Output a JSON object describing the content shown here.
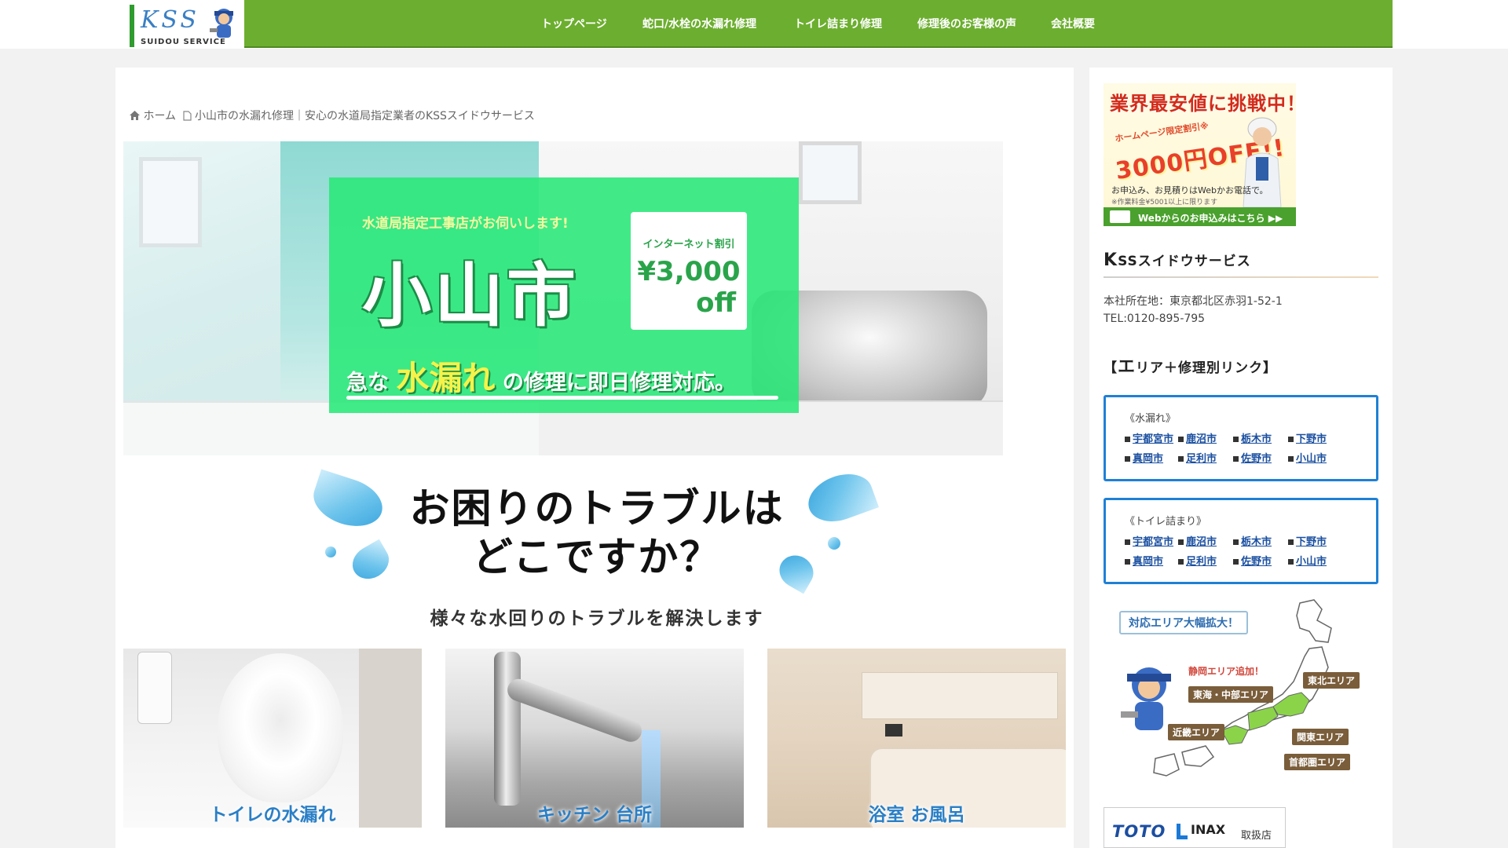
{
  "header": {
    "logo_text": "KSS",
    "logo_sub": "SUIDOU SERVICE",
    "nav": [
      "トップページ",
      "蛇口/水栓の水漏れ修理",
      "トイレ詰まり修理",
      "修理後のお客様の声",
      "会社概要"
    ]
  },
  "breadcrumb": {
    "home": "ホーム",
    "current": "小山市の水漏れ修理｜安心の水道局指定業者のKSSスイドウサービス"
  },
  "hero": {
    "top_line": "水道局指定工事店がお伺いします!",
    "city": "小山市",
    "discount_label": "インターネット割引",
    "discount_amount": "¥3,000",
    "discount_off": "off",
    "bottom_prefix": "急な",
    "bottom_highlight": "水漏れ",
    "bottom_suffix": "の修理に即日修理対応。"
  },
  "trouble": {
    "title_line1": "お困りのトラブルは",
    "title_line2": "どこですか？",
    "subtitle": "様々な水回りのトラブルを解決します"
  },
  "cards": [
    {
      "label": "トイレの水漏れ"
    },
    {
      "label": "キッチン 台所"
    },
    {
      "label": "浴室 お風呂"
    }
  ],
  "sidebar": {
    "banner": {
      "title": "業界最安値に挑戦中！",
      "discount_label": "ホームページ限定割引※",
      "discount": "3000円OFF!!",
      "note": "お申込み、お見積りはWebかお電話で。",
      "note_small": "※作業料金¥5001以上に限ります",
      "button": "Webからのお申込みはこちら ▶▶"
    },
    "company": {
      "heading_initial": "K",
      "heading_rest": "SSスイドウサービス",
      "address": "本社所在地：東京都北区赤羽1-52-1",
      "tel": "TEL:0120-895-795"
    },
    "area_heading": {
      "open": "【",
      "initial": "エ",
      "rest": "リア＋修理別リンク】"
    },
    "link_boxes": [
      {
        "title": "《水漏れ》",
        "links": [
          "宇都宮市",
          "鹿沼市",
          "栃木市",
          "下野市",
          "真岡市",
          "足利市",
          "佐野市",
          "小山市"
        ]
      },
      {
        "title": "《トイレ詰まり》",
        "links": [
          "宇都宮市",
          "鹿沼市",
          "栃木市",
          "下野市",
          "真岡市",
          "足利市",
          "佐野市",
          "小山市"
        ]
      }
    ],
    "map": {
      "callout": "対応エリア大幅拡大！",
      "added": "静岡エリア追加！",
      "tags": [
        "東北エリア",
        "東海・中部エリア",
        "近畿エリア",
        "関東エリア",
        "首都圏エリア"
      ]
    },
    "maker": {
      "toto": "TOTO",
      "inax": "INAX",
      "shop": "取扱店"
    }
  }
}
